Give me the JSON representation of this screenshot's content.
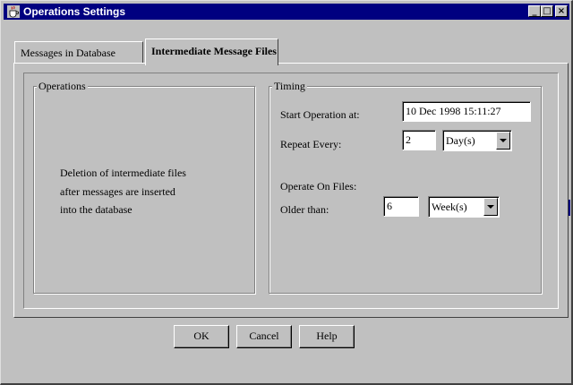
{
  "window": {
    "title": "Operations Settings",
    "icon": "java-cup-icon",
    "controls": {
      "minimize": "_",
      "maximize": "□",
      "close": "×"
    }
  },
  "tabs": [
    {
      "label": "Messages in Database",
      "selected": false
    },
    {
      "label": "Intermediate Message Files",
      "selected": true
    }
  ],
  "operations": {
    "legend": "Operations",
    "lines": [
      "Deletion of intermediate files",
      "after messages are inserted",
      "into the database"
    ]
  },
  "timing": {
    "legend": "Timing",
    "start_label": "Start Operation at:",
    "start_value": "10 Dec 1998 15:11:27",
    "repeat_label": "Repeat Every:",
    "repeat_value": "2",
    "repeat_unit": "Day(s)",
    "operate_label": "Operate On Files:",
    "older_label": "Older than:",
    "older_value": "6",
    "older_unit": "Week(s)"
  },
  "buttons": {
    "ok": "OK",
    "cancel": "Cancel",
    "help": "Help"
  },
  "colors": {
    "titlebar": "#000080",
    "face": "#c0c0c0"
  }
}
